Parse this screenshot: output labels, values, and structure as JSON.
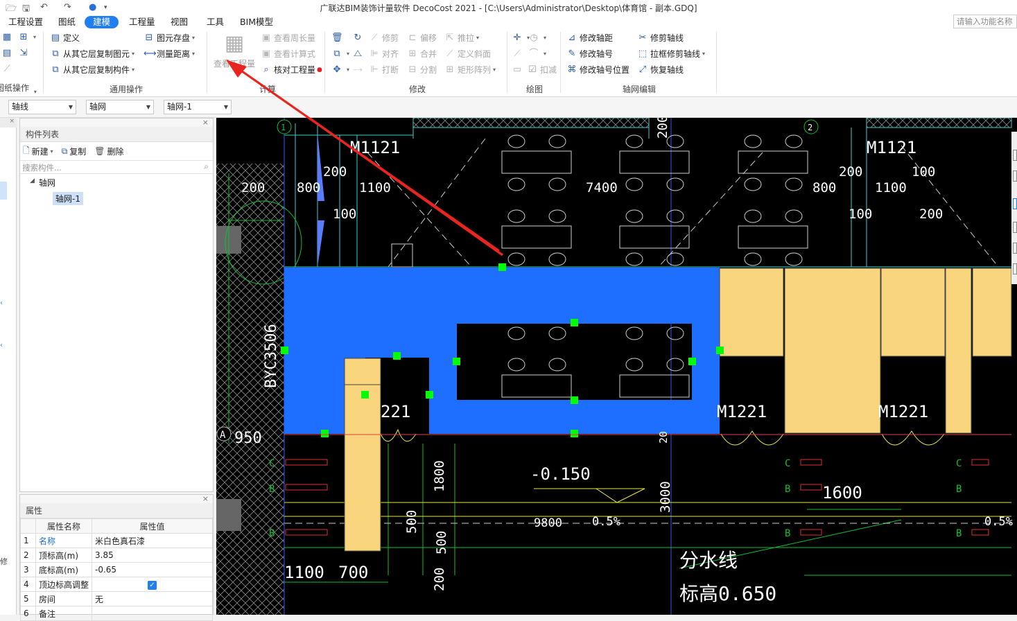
{
  "window": {
    "title": "广联达BIM装饰计量软件 DecoCost 2021 - [C:\\Users\\Administrator\\Desktop\\体育馆 - 副本.GDQ]"
  },
  "menu": {
    "tabs": [
      "工程设置",
      "图纸",
      "建模",
      "工程量",
      "视图",
      "工具",
      "BIM模型"
    ],
    "active": "建模",
    "search_placeholder": "请输入功能名称"
  },
  "ribbon": {
    "general": {
      "define": "定义",
      "copy_elem": "从其它层复制图元",
      "copy_comp": "从其它层复制构件",
      "save_elem": "图元存盘",
      "measure": "测量距离",
      "group": "通用操作"
    },
    "drawing_ops": {
      "group": "图纸操作"
    },
    "calc": {
      "view_qty": "查看工程量",
      "view_perimeter": "查看周长量",
      "view_formula": "查看计算式",
      "check_qty": "核对工程量",
      "group": "计算"
    },
    "modify": {
      "trim": "修剪",
      "offset": "偏移",
      "push": "推拉",
      "align": "对齐",
      "merge": "合并",
      "slope": "定义斜面",
      "break": "打断",
      "split": "分割",
      "rect_array": "矩形阵列",
      "group": "修改"
    },
    "draw": {
      "deduct": "扣减",
      "group": "绘图"
    },
    "axis": {
      "mod_dist": "修改轴距",
      "mod_no": "修改轴号",
      "mod_pos": "修改轴号位置",
      "trim_axis": "修剪轴线",
      "box_trim": "拉框修剪轴线",
      "restore": "恢复轴线",
      "group": "轴网编辑"
    }
  },
  "filters": [
    "轴线",
    "轴网",
    "轴网-1"
  ],
  "component_panel": {
    "title": "构件列表",
    "new": "新建",
    "copy": "复制",
    "delete": "删除",
    "search_placeholder": "搜索构件...",
    "tree_root": "轴网",
    "tree_child": "轴网-1"
  },
  "properties": {
    "title": "属性",
    "headers": [
      "属性名称",
      "属性值"
    ],
    "rows": [
      {
        "no": "1",
        "name": "名称",
        "value": "米白色真石漆"
      },
      {
        "no": "2",
        "name": "顶标高(m)",
        "value": "3.85"
      },
      {
        "no": "3",
        "name": "底标高(m)",
        "value": "-0.65"
      },
      {
        "no": "4",
        "name": "顶边标高调整",
        "value": ""
      },
      {
        "no": "5",
        "name": "房间",
        "value": "无"
      },
      {
        "no": "6",
        "name": "备注",
        "value": ""
      }
    ]
  },
  "cad": {
    "labels": [
      "M1121",
      "M1121",
      "200",
      "800",
      "1100",
      "7400",
      "200",
      "800",
      "1100",
      "100",
      "100",
      "200",
      "100",
      "200",
      "BYC3506",
      "221",
      "M1221",
      "M1221",
      "A",
      "950",
      "-0.150",
      "1800",
      "500",
      "500",
      "200",
      "3000",
      "9800",
      "0.5%",
      "0.5%",
      "1600",
      "1100",
      "700",
      "分水线",
      "标高0.650",
      "1",
      "2",
      "C",
      "C",
      "C",
      "B",
      "B",
      "B",
      "B",
      "B",
      "B",
      "20"
    ]
  },
  "colors": {
    "accent": "#1f7ef0",
    "selection": "#1e6fff",
    "wall": "#f9d67d",
    "grip": "#00ff00",
    "arrow": "#e8251f"
  }
}
